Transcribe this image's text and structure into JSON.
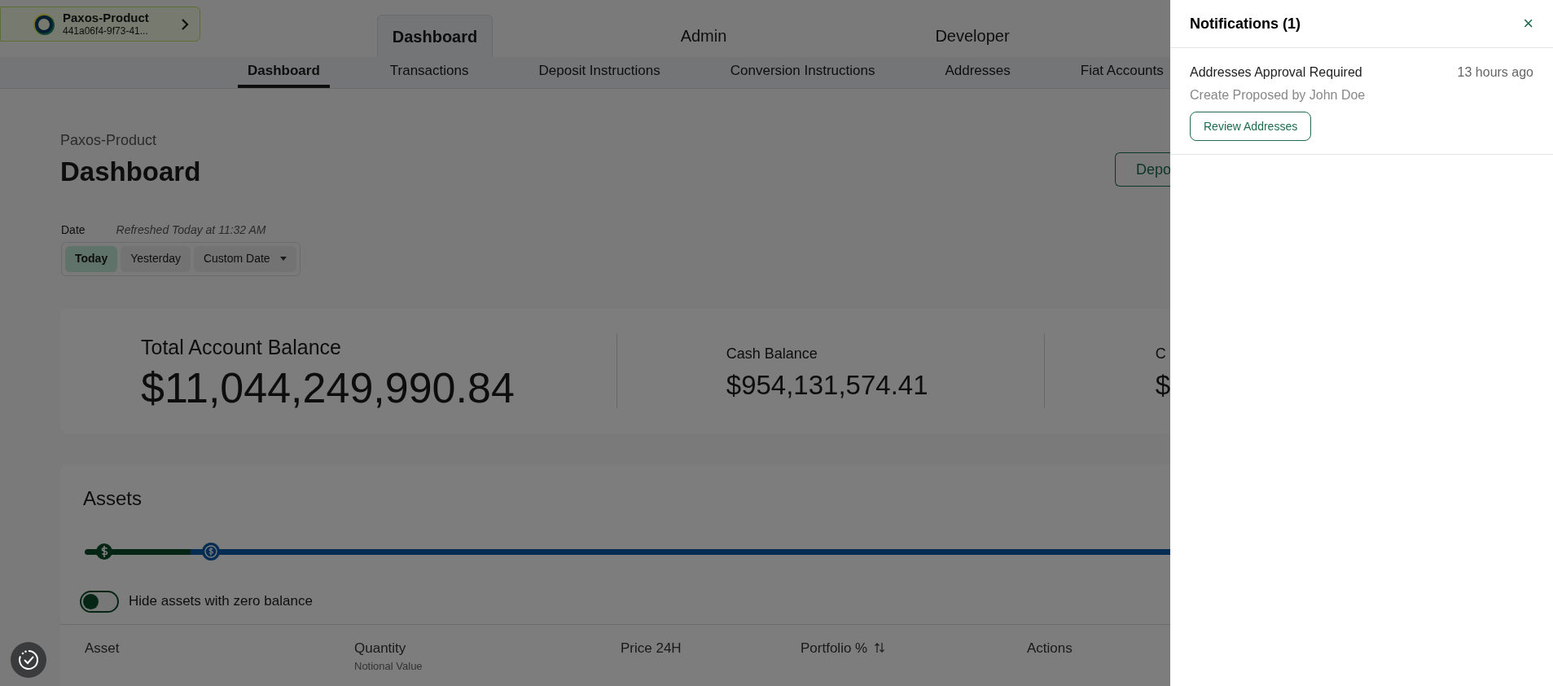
{
  "account": {
    "name": "Paxos-Product",
    "id": "441a06f4-9f73-41..."
  },
  "top_tabs": [
    {
      "label": "Dashboard",
      "selected": true
    },
    {
      "label": "Admin",
      "selected": false
    },
    {
      "label": "Developer",
      "selected": false
    }
  ],
  "sub_tabs": [
    {
      "label": "Dashboard",
      "selected": true
    },
    {
      "label": "Transactions",
      "selected": false
    },
    {
      "label": "Deposit Instructions",
      "selected": false
    },
    {
      "label": "Conversion Instructions",
      "selected": false
    },
    {
      "label": "Addresses",
      "selected": false
    },
    {
      "label": "Fiat Accounts",
      "selected": false
    }
  ],
  "page": {
    "breadcrumb": "Paxos-Product",
    "title": "Dashboard",
    "action_button": "Depo"
  },
  "date_filter": {
    "label": "Date",
    "refreshed": "Refreshed Today at 11:32 AM",
    "options": [
      {
        "label": "Today",
        "selected": true,
        "kind": "plain"
      },
      {
        "label": "Yesterday",
        "selected": false,
        "kind": "plain"
      },
      {
        "label": "Custom Date",
        "selected": false,
        "kind": "dropdown"
      }
    ]
  },
  "balances": [
    {
      "label": "Total Account Balance",
      "value": "$11,044,249,990.84",
      "kind": "primary"
    },
    {
      "label": "Cash Balance",
      "value": "$954,131,574.41",
      "kind": "secondary"
    },
    {
      "label": "C",
      "value": "$",
      "kind": "secondary"
    }
  ],
  "assets": {
    "title": "Assets",
    "hide_zero": {
      "label": "Hide assets with zero balance",
      "on": false
    },
    "columns": [
      {
        "label": "Asset"
      },
      {
        "label": "Quantity",
        "sublabel": "Notional Value"
      },
      {
        "label": "Price 24H"
      },
      {
        "label": "Portfolio %",
        "sortable": true
      },
      {
        "label": "Actions"
      }
    ]
  },
  "notifications": {
    "title": "Notifications (1)",
    "close": "×",
    "items": [
      {
        "title": "Addresses Approval Required",
        "time": "13 hours ago",
        "subtitle": "Create Proposed by John Doe",
        "action": "Review Addresses"
      }
    ]
  }
}
